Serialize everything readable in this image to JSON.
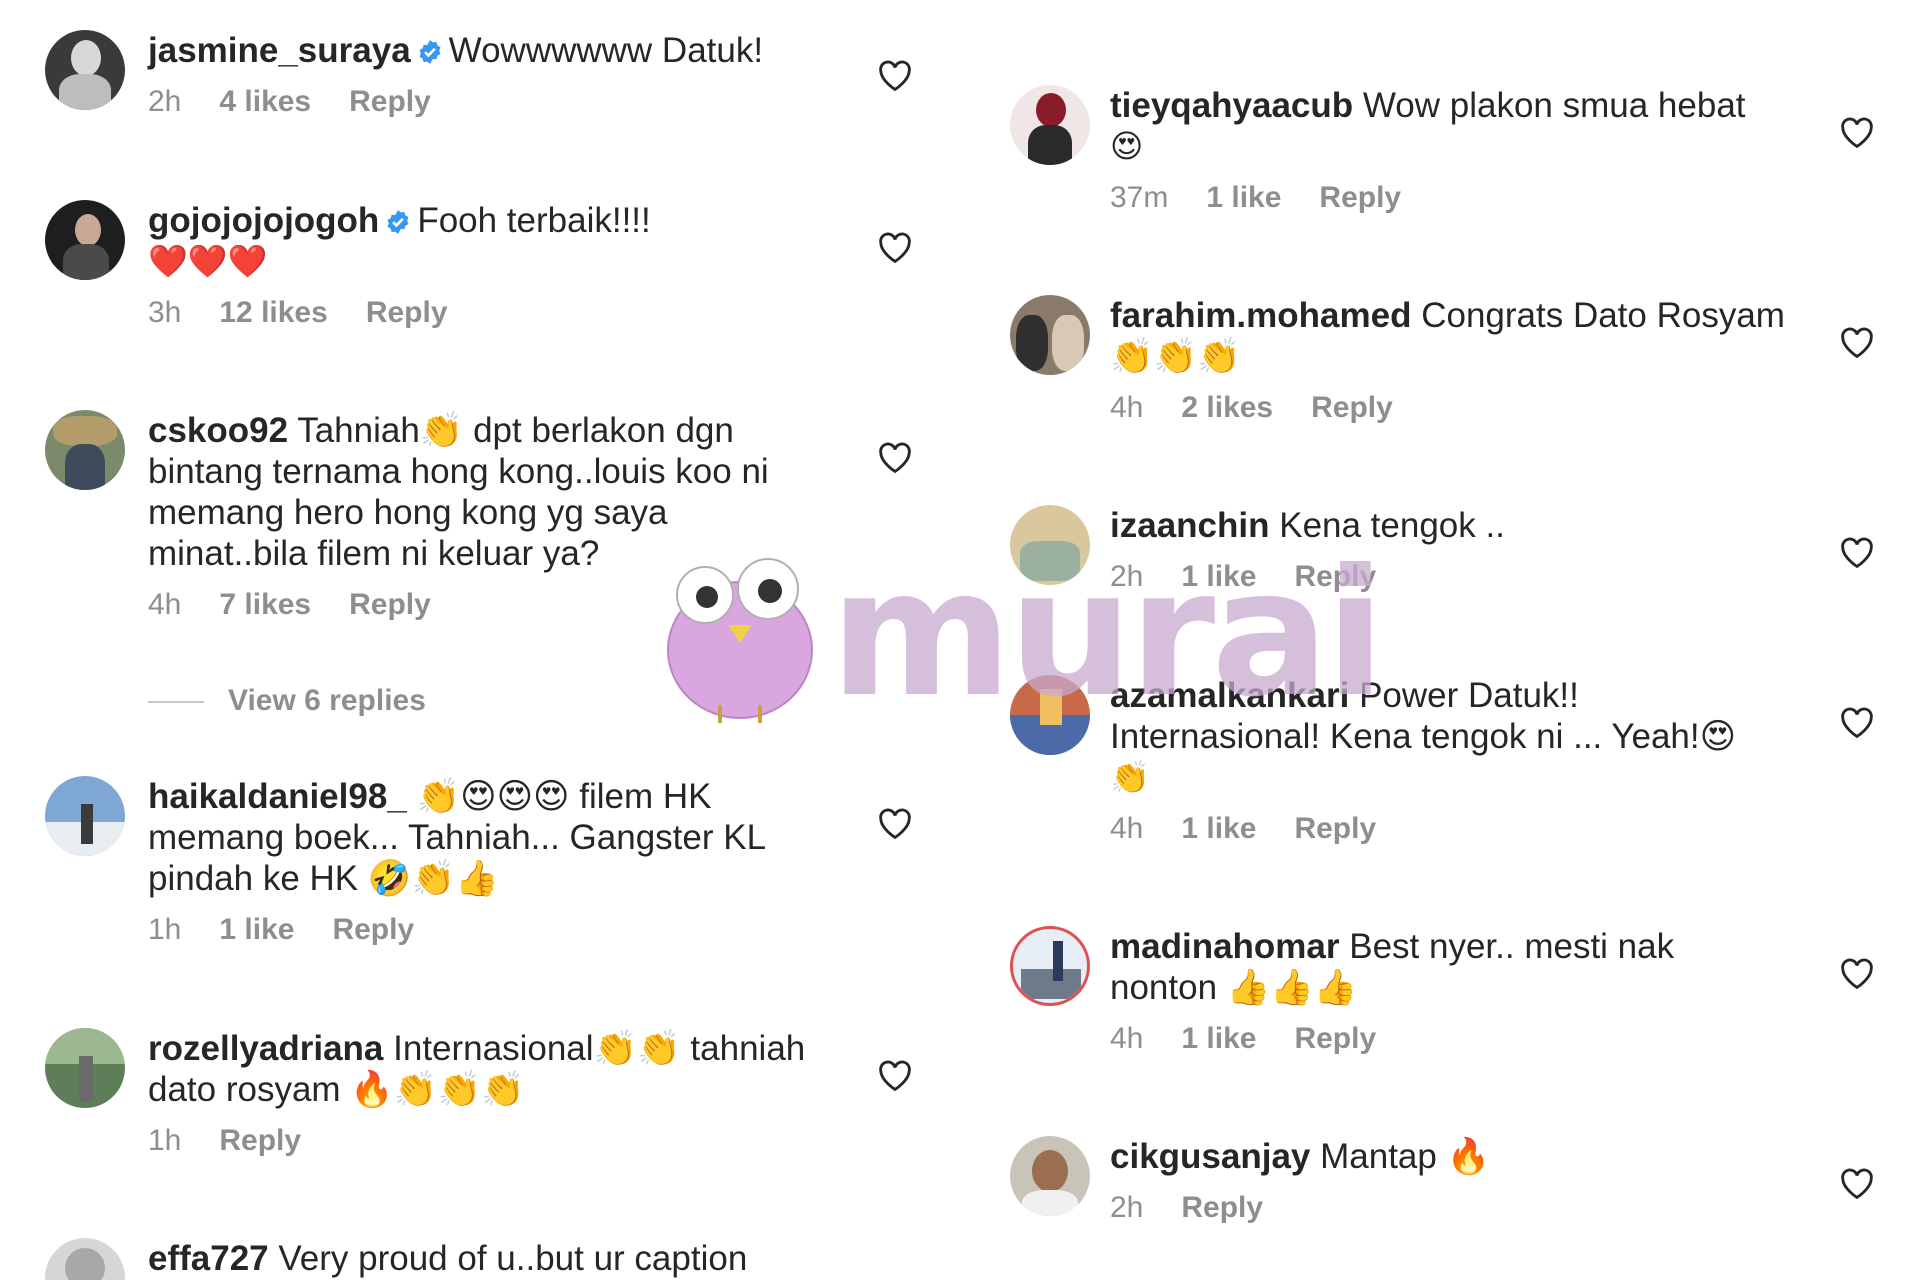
{
  "colors": {
    "text": "#262626",
    "meta": "#8e8e8e",
    "verified": "#3897f0",
    "heart_outline": "#262626",
    "watermark": "#c8aacd"
  },
  "watermark": {
    "text": "murai"
  },
  "left_column": {
    "comments": [
      {
        "username": "jasmine_suraya",
        "verified": true,
        "text": "Wowwwwww Datuk!",
        "emojis": "",
        "time": "2h",
        "likes": "4 likes",
        "reply": "Reply"
      },
      {
        "username": "gojojojojogoh",
        "verified": true,
        "text": "Fooh terbaik!!!!",
        "emojis": "❤️❤️❤️",
        "time": "3h",
        "likes": "12 likes",
        "reply": "Reply"
      },
      {
        "username": "cskoo92",
        "verified": false,
        "text": "Tahniah👏 dpt berlakon dgn bintang ternama hong kong..louis koo ni memang hero hong kong yg saya minat..bila filem ni keluar ya?",
        "emojis": "",
        "time": "4h",
        "likes": "7 likes",
        "reply": "Reply"
      },
      {
        "username": "haikaldaniel98_",
        "verified": false,
        "text": "👏😍😍😍 filem HK memang boek... Tahniah... Gangster KL pindah ke HK 🤣👏👍",
        "emojis": "",
        "time": "1h",
        "likes": "1 like",
        "reply": "Reply"
      },
      {
        "username": "rozellyadriana",
        "verified": false,
        "text": "Internasional👏👏 tahniah dato rosyam 🔥👏👏👏",
        "emojis": "",
        "time": "1h",
        "likes": "",
        "reply": "Reply"
      },
      {
        "username": "effa727",
        "verified": false,
        "text": "Very proud of u..but ur caption",
        "emojis": "",
        "time": "",
        "likes": "",
        "reply": ""
      }
    ],
    "view_replies": "View 6 replies"
  },
  "right_column": {
    "comments": [
      {
        "username": "tieyqahyaacub",
        "text": "Wow plakon smua hebat",
        "emojis": "😍",
        "time": "37m",
        "likes": "1 like",
        "reply": "Reply"
      },
      {
        "username": "farahim.mohamed",
        "text": "Congrats Dato Rosyam 👏👏👏",
        "emojis": "",
        "time": "4h",
        "likes": "2 likes",
        "reply": "Reply"
      },
      {
        "username": "izaanchin",
        "text": "Kena tengok ..",
        "emojis": "",
        "time": "2h",
        "likes": "1 like",
        "reply": "Reply"
      },
      {
        "username": "azamalkankari",
        "text": "Power Datuk!! Internasional! Kena tengok ni ... Yeah!😍",
        "emojis": "👏",
        "time": "4h",
        "likes": "1 like",
        "reply": "Reply"
      },
      {
        "username": "madinahomar",
        "text": "Best nyer.. mesti nak nonton 👍👍👍",
        "emojis": "",
        "time": "4h",
        "likes": "1 like",
        "reply": "Reply"
      },
      {
        "username": "cikgusanjay",
        "text": "Mantap 🔥",
        "emojis": "",
        "time": "2h",
        "likes": "",
        "reply": "Reply"
      }
    ]
  }
}
